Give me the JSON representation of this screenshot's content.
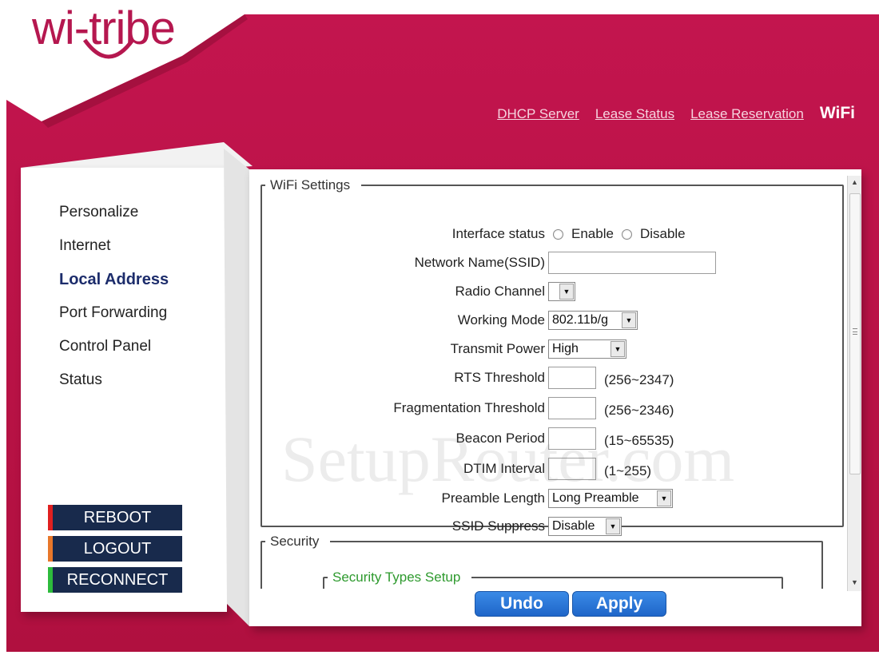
{
  "brand": {
    "logo_text": "wi-tribe"
  },
  "colors": {
    "brand": "#b5174f",
    "frame": "#c3154e",
    "button_blue": "#2a78dd",
    "side_button": "#182a4c"
  },
  "top_nav": {
    "links": [
      "DHCP Server",
      "Lease Status",
      "Lease Reservation"
    ],
    "active": "WiFi"
  },
  "sidebar": {
    "items": [
      {
        "label": "Personalize"
      },
      {
        "label": "Internet"
      },
      {
        "label": "Local Address",
        "current": true
      },
      {
        "label": "Port Forwarding"
      },
      {
        "label": "Control Panel"
      },
      {
        "label": "Status"
      }
    ],
    "buttons": {
      "reboot": "REBOOT",
      "logout": "LOGOUT",
      "reconnect": "RECONNECT"
    }
  },
  "wifi_settings": {
    "legend": "WiFi Settings",
    "interface_status": {
      "label": "Interface status",
      "enable": "Enable",
      "disable": "Disable"
    },
    "ssid": {
      "label": "Network Name(SSID)",
      "value": ""
    },
    "radio_channel": {
      "label": "Radio Channel",
      "value": ""
    },
    "working_mode": {
      "label": "Working Mode",
      "value": "802.11b/g"
    },
    "transmit_power": {
      "label": "Transmit Power",
      "value": "High"
    },
    "rts_threshold": {
      "label": "RTS Threshold",
      "value": "",
      "hint": "(256~2347)"
    },
    "fragmentation_threshold": {
      "label": "Fragmentation Threshold",
      "value": "",
      "hint": "(256~2346)"
    },
    "beacon_period": {
      "label": "Beacon Period",
      "value": "",
      "hint": "(15~65535)"
    },
    "dtim_interval": {
      "label": "DTIM Interval",
      "value": "",
      "hint": "(1~255)"
    },
    "preamble_length": {
      "label": "Preamble Length",
      "value": "Long Preamble"
    },
    "ssid_suppress": {
      "label": "SSID Suppress",
      "value": "Disable"
    }
  },
  "security": {
    "legend": "Security",
    "types_legend": "Security Types Setup"
  },
  "actions": {
    "undo": "Undo",
    "apply": "Apply"
  },
  "watermark": "SetupRouter.com"
}
